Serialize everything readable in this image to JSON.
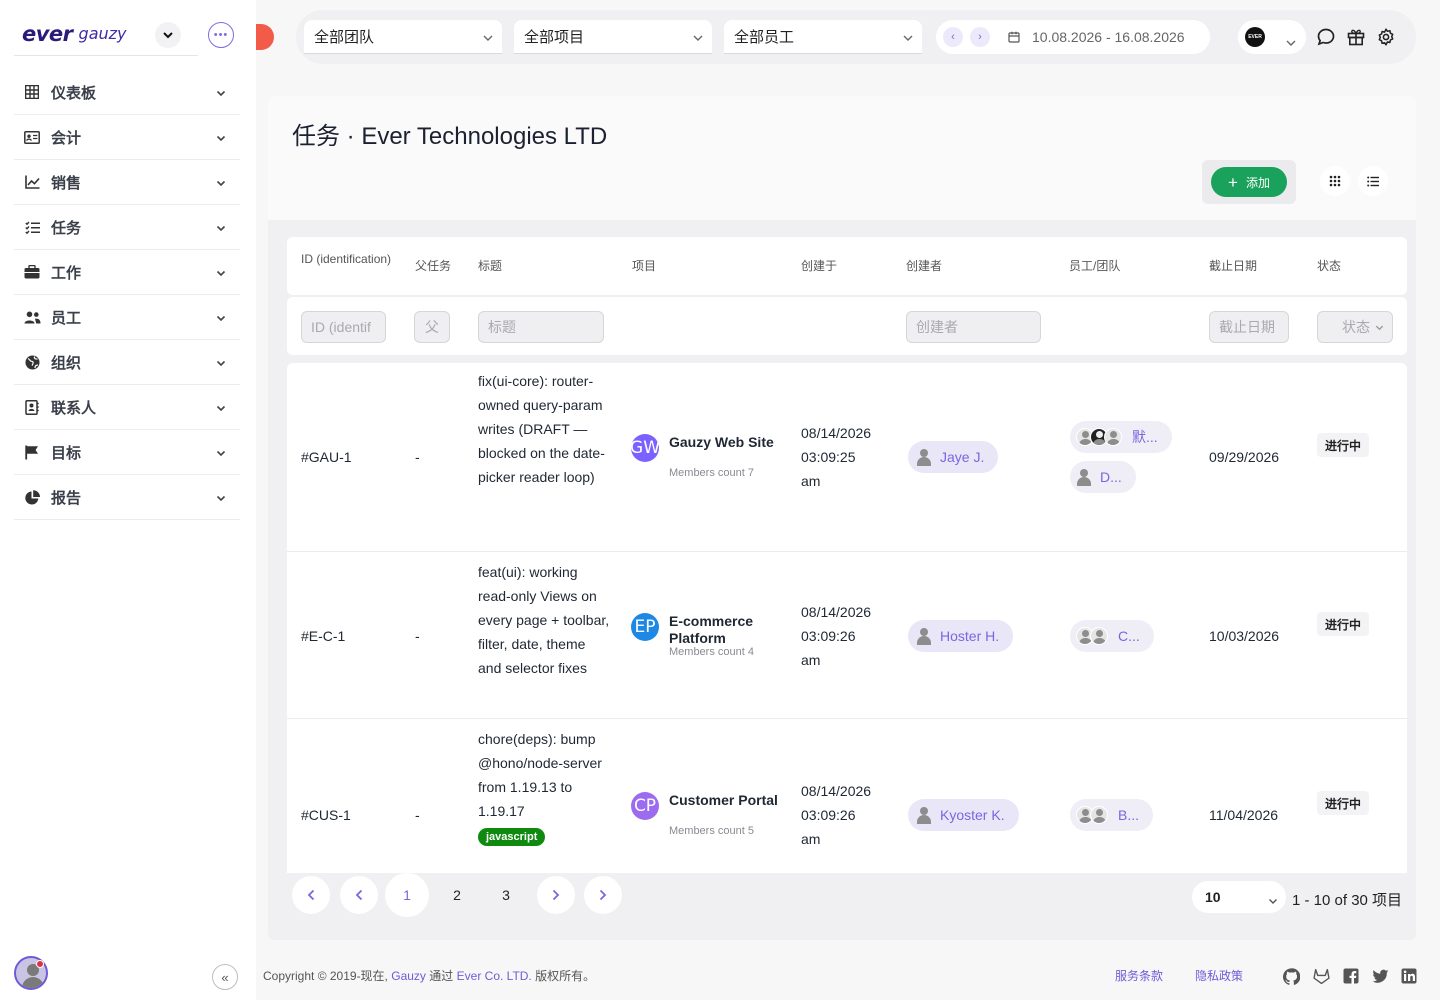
{
  "sidebar": {
    "logo_primary": "ever",
    "logo_secondary": "gauzy",
    "menu": [
      {
        "label": "仪表板",
        "icon": "dashboard-grid-icon"
      },
      {
        "label": "会计",
        "icon": "accounting-card-icon"
      },
      {
        "label": "销售",
        "icon": "sales-chart-icon"
      },
      {
        "label": "任务",
        "icon": "tasks-list-icon"
      },
      {
        "label": "工作",
        "icon": "briefcase-icon"
      },
      {
        "label": "员工",
        "icon": "employees-icon"
      },
      {
        "label": "组织",
        "icon": "globe-icon"
      },
      {
        "label": "联系人",
        "icon": "contacts-icon"
      },
      {
        "label": "目标",
        "icon": "flag-icon"
      },
      {
        "label": "报告",
        "icon": "pie-chart-icon"
      }
    ]
  },
  "topbar": {
    "team_select": "全部团队",
    "project_select": "全部项目",
    "employee_select": "全部员工",
    "date_range": "10.08.2026 - 16.08.2026",
    "org_logo_text": "EVER"
  },
  "page": {
    "title": "任务 · Ever Technologies LTD",
    "add_label": "添加"
  },
  "table": {
    "headers": {
      "id": "ID (identification)",
      "parent": "父任务",
      "title": "标题",
      "project": "项目",
      "created": "创建于",
      "creator": "创建者",
      "employee_team": "员工/团队",
      "due": "截止日期",
      "status": "状态"
    },
    "filters": {
      "id_placeholder": "ID (identif",
      "parent_placeholder": "父",
      "title_placeholder": "标题",
      "creator_placeholder": "创建者",
      "due_placeholder": "截止日期",
      "status_placeholder": "状态"
    },
    "rows": [
      {
        "id": "#GAU-1",
        "parent": "-",
        "title": "fix(ui-core): router-owned query-param writes (DRAFT — blocked on the date-picker reader loop)",
        "tag": "",
        "project_initials": "GW",
        "project_color": "#7b61ff",
        "project_name": "Gauzy Web Site",
        "project_members": "Members count 7",
        "created_date": "08/14/2026",
        "created_time": "03:09:25",
        "created_ampm": "am",
        "creator": "Jaye J.",
        "assignee_1": "默...",
        "assignee_2": "D...",
        "due": "09/29/2026",
        "status": "进行中"
      },
      {
        "id": "#E-C-1",
        "parent": "-",
        "title": "feat(ui): working read-only Views on every page + toolbar, filter, date, theme and selector fixes",
        "tag": "",
        "project_initials": "EP",
        "project_color": "#1e88e5",
        "project_name": "E-commerce Platform",
        "project_members": "Members count 4",
        "created_date": "08/14/2026",
        "created_time": "03:09:26",
        "created_ampm": "am",
        "creator": "Hoster H.",
        "assignee_1": "C...",
        "assignee_2": "",
        "due": "10/03/2026",
        "status": "进行中"
      },
      {
        "id": "#CUS-1",
        "parent": "-",
        "title": "chore(deps): bump @hono/node-server from 1.19.13 to 1.19.17",
        "tag": "javascript",
        "project_initials": "CP",
        "project_color": "#9d6bf0",
        "project_name": "Customer Portal",
        "project_members": "Members count 5",
        "created_date": "08/14/2026",
        "created_time": "03:09:26",
        "created_ampm": "am",
        "creator": "Kyoster K.",
        "assignee_1": "B...",
        "assignee_2": "",
        "due": "11/04/2026",
        "status": "进行中"
      }
    ]
  },
  "pagination": {
    "pages": [
      "1",
      "2",
      "3"
    ],
    "current": "1",
    "per_page": "10",
    "range_text": "1 - 10 of 30 项目"
  },
  "footer": {
    "copyright_prefix": "Copyright © 2019-现在,",
    "gauzy_link": "Gauzy",
    "via": "通过",
    "company_link": "Ever Co. LTD.",
    "rights": "版权所有。",
    "terms": "服务条款",
    "privacy": "隐私政策"
  },
  "colors": {
    "accent": "#7a66e0",
    "add_button": "#1aa15c",
    "notification": "#f15b48"
  }
}
